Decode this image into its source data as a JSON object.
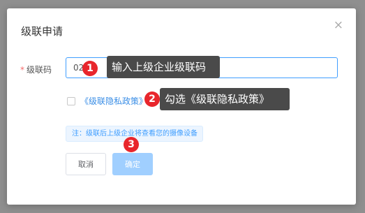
{
  "dialog": {
    "title": "级联申请",
    "close_icon": "×"
  },
  "form": {
    "required_mark": "*",
    "code_label": "级联码",
    "code_value": "02",
    "policy_link": "《级联隐私政策》",
    "note": "注：级联后上级企业将查看您的摄像设备",
    "cancel_label": "取消",
    "ok_label": "确定"
  },
  "tutorial": {
    "badge1": "1",
    "tip1": "输入上级企业级联码",
    "badge2": "2",
    "tip2": "勾选《级联隐私政策》",
    "badge3": "3"
  },
  "colors": {
    "primary": "#409eff",
    "badge": "#e8262c",
    "overlay": "#8f8f8f"
  }
}
